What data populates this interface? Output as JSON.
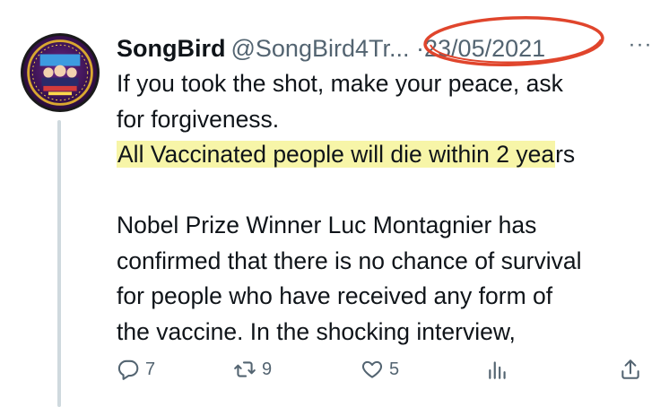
{
  "author": {
    "display_name": "SongBird",
    "handle": "@SongBird4Tr...",
    "separator": "·",
    "date": "23/05/2021"
  },
  "tweet": {
    "line1": "If you took the shot, make your peace, ask",
    "line2": "for forgiveness.",
    "line3_highlighted": "All Vaccinated people will die within 2 yea",
    "line3_rest": "rs",
    "para2_line1": "Nobel Prize Winner Luc Montagnier has",
    "para2_line2": "confirmed that there is no chance of survival",
    "para2_line3": "for people who have received any form of",
    "para2_line4": "the vaccine. In the shocking interview,"
  },
  "actions": {
    "replies": "7",
    "retweets": "9",
    "likes": "5"
  },
  "more_label": "···",
  "colors": {
    "text": "#0f1419",
    "secondary": "#536471",
    "highlight": "#f7f5a8",
    "annotation_red": "#e0452c",
    "thread_line": "#cfd9de"
  },
  "icons": [
    "more-icon",
    "reply-icon",
    "retweet-icon",
    "like-icon",
    "views-icon",
    "share-icon"
  ]
}
